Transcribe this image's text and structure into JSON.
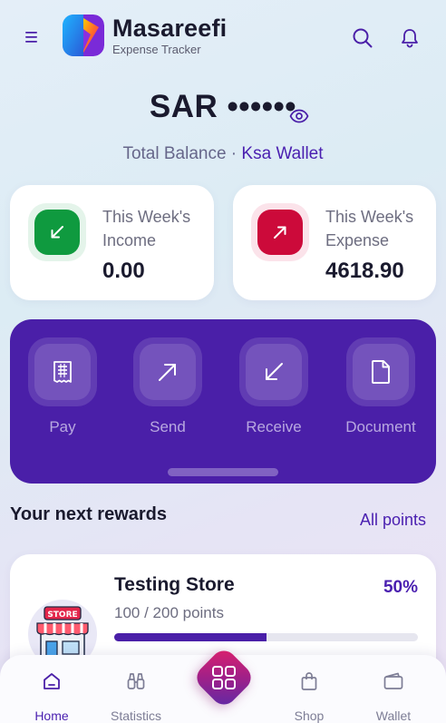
{
  "header": {
    "app_name": "Masareefi",
    "tagline": "Expense Tracker",
    "icons": [
      "menu-icon",
      "search-icon",
      "bell-icon"
    ]
  },
  "balance": {
    "masked_amount": "SAR ••••••",
    "label": "Total Balance · ",
    "wallet_name": "Ksa Wallet"
  },
  "income": {
    "label": "This Week's Income",
    "value": "0.00",
    "color": "#0f9a3f"
  },
  "expense": {
    "label": "This Week's Expense",
    "value": "4618.90",
    "color": "#cc0a3a"
  },
  "actions": [
    {
      "label": "Pay",
      "icon": "receipt-icon"
    },
    {
      "label": "Send",
      "icon": "arrow-up-right-icon"
    },
    {
      "label": "Receive",
      "icon": "arrow-down-left-icon"
    },
    {
      "label": "Document",
      "icon": "document-icon"
    }
  ],
  "rewards": {
    "title": "Your next rewards",
    "link": "All points",
    "store_name": "Testing Store",
    "store_sign": "STORE",
    "percent": "50%",
    "points_text": "100 / 200 points",
    "progress": 0.5
  },
  "nav": {
    "items": [
      {
        "label": "Home",
        "icon": "home-icon",
        "active": true
      },
      {
        "label": "Statistics",
        "icon": "binoculars-icon",
        "active": false
      },
      {
        "label": "Shop",
        "icon": "shopping-bag-icon",
        "active": false
      },
      {
        "label": "Wallet",
        "icon": "wallet-icon",
        "active": false
      }
    ],
    "center_icon": "grid-icon"
  },
  "colors": {
    "accent": "#4a1fa8",
    "brand_purple": "#4a1fb0",
    "center_gradient": [
      "#e0206a",
      "#5a2aa8"
    ]
  }
}
